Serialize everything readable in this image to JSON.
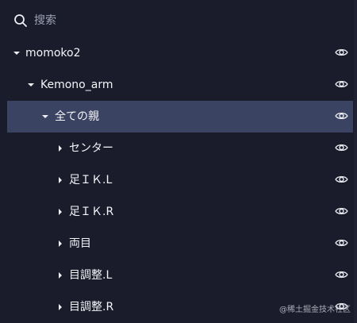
{
  "search": {
    "placeholder": "搜索",
    "value": ""
  },
  "tree": {
    "items": [
      {
        "label": "momoko2",
        "expanded": true,
        "selected": false
      },
      {
        "label": "Kemono_arm",
        "expanded": true,
        "selected": false
      },
      {
        "label": "全ての親",
        "expanded": true,
        "selected": true
      },
      {
        "label": "センター",
        "expanded": false,
        "selected": false
      },
      {
        "label": "足ＩＫ.L",
        "expanded": false,
        "selected": false
      },
      {
        "label": "足ＩＫ.R",
        "expanded": false,
        "selected": false
      },
      {
        "label": "両目",
        "expanded": false,
        "selected": false
      },
      {
        "label": "目調整.L",
        "expanded": false,
        "selected": false
      },
      {
        "label": "目調整.R",
        "expanded": false,
        "selected": false
      }
    ]
  },
  "watermark": {
    "text": "@稀土掘金技术社区"
  },
  "colors": {
    "background": "#1b1c2b",
    "selected_row": "#3a4361",
    "text": "#eef0f5",
    "muted_text": "#9ca2b5"
  },
  "icons": {
    "search": "search-icon",
    "expand": "triangle-down-icon",
    "collapse": "triangle-right-icon",
    "visibility": "eye-icon"
  }
}
